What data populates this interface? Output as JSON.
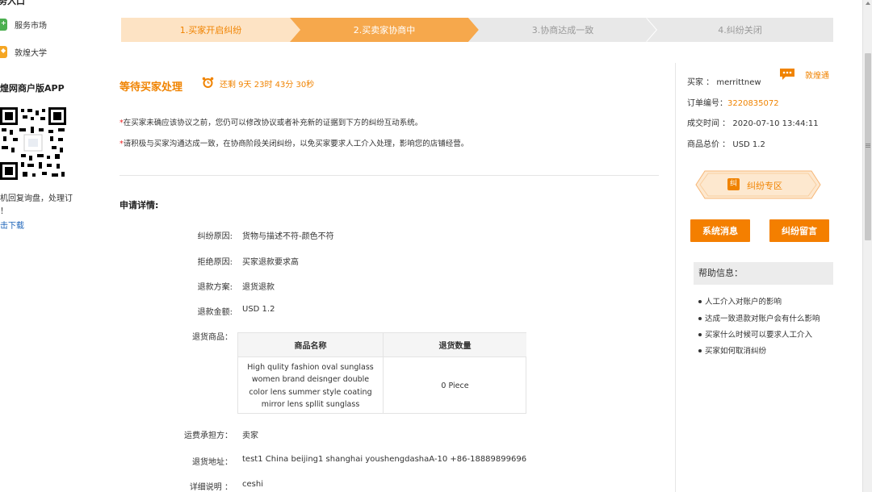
{
  "sidebar": {
    "header": "务入口",
    "items": [
      {
        "label": "服务市场",
        "icon": "service-market-icon",
        "color": "#4caf50"
      },
      {
        "label": "敦煌大学",
        "icon": "dh-university-icon",
        "color": "#f5a623"
      }
    ],
    "app_title": "煌网商户版APP",
    "qr_icon": "qr-code-icon",
    "note_line1": "机回复询盘，处理订",
    "note_line2": "！",
    "download_link": "击下载"
  },
  "steps": [
    {
      "label": "1.买家开启纠纷",
      "state": "done"
    },
    {
      "label": "2.买卖家协商中",
      "state": "active"
    },
    {
      "label": "3.协商达成一致",
      "state": "pending"
    },
    {
      "label": "4.纠纷关闭",
      "state": "pending"
    }
  ],
  "status": {
    "title": "等待买家处理",
    "clock_icon": "alarm-clock-icon",
    "countdown": "还剩 9天 23时 43分 30秒"
  },
  "notices": [
    {
      "star": "*",
      "text": "在买家未确应该协议之前，您仍可以修改协议或者补充新的证据到下方的纠纷互动系统。"
    },
    {
      "star": "*",
      "text": "请积极与买家沟通达成一致，在协商阶段关闭纠纷，以免买家要求人工介入处理，影响您的店铺经营。"
    }
  ],
  "details": {
    "section_title": "申请详情:",
    "fields": [
      {
        "label": "纠纷原因:",
        "value": "货物与描述不符-颜色不符"
      },
      {
        "label": "拒绝原因:",
        "value": "买家退款要求高"
      },
      {
        "label": "退款方案:",
        "value": "退货退款"
      },
      {
        "label": "退款金额:",
        "value": "USD 1.2"
      }
    ],
    "goods_label": "退货商品：",
    "goods_table": {
      "headers": [
        "商品名称",
        "退货数量"
      ],
      "rows": [
        {
          "name": "High qulity fashion oval sunglass women brand deisnger double color lens summer style coating mirror lens spllit sunglass",
          "qty": "0 Piece"
        }
      ]
    },
    "shipping_label": "运费承担方：",
    "shipping_value": "卖家",
    "address_label": "退货地址：",
    "address_value": "test1 China beijing1 shanghai youshengdashaA-10 +86-18889899696",
    "desc_label": "详细说明 ：",
    "desc_value": "ceshi"
  },
  "order": {
    "buyer_label": "买家 ：",
    "buyer_value": "merrittnew",
    "chat_icon": "chat-bubble-icon",
    "chat_label": "敦煌通",
    "order_no_label": "订单编号：",
    "order_no_value": "3220835072",
    "time_label": "成交时间 ：",
    "time_value": "2020-07-10 13:44:11",
    "total_label": "商品总价 ：",
    "total_value": "USD 1.2",
    "dispute_zone_label": "纠纷专区",
    "dispute_zone_icon": "dispute-icon",
    "btn_system": "系统消息",
    "btn_message": "纠纷留言",
    "help_title": "帮助信息：",
    "help_items": [
      "人工介入对账户的影响",
      "达成一致退款对账户会有什么影响",
      "买家什么时候可以要求人工介入",
      "买家如何取消纠纷"
    ]
  },
  "colors": {
    "accent": "#f08300",
    "step_done": "#fde3c4",
    "step_active": "#f6a84c",
    "step_pending": "#e8e8e8",
    "button": "#f47f00"
  }
}
